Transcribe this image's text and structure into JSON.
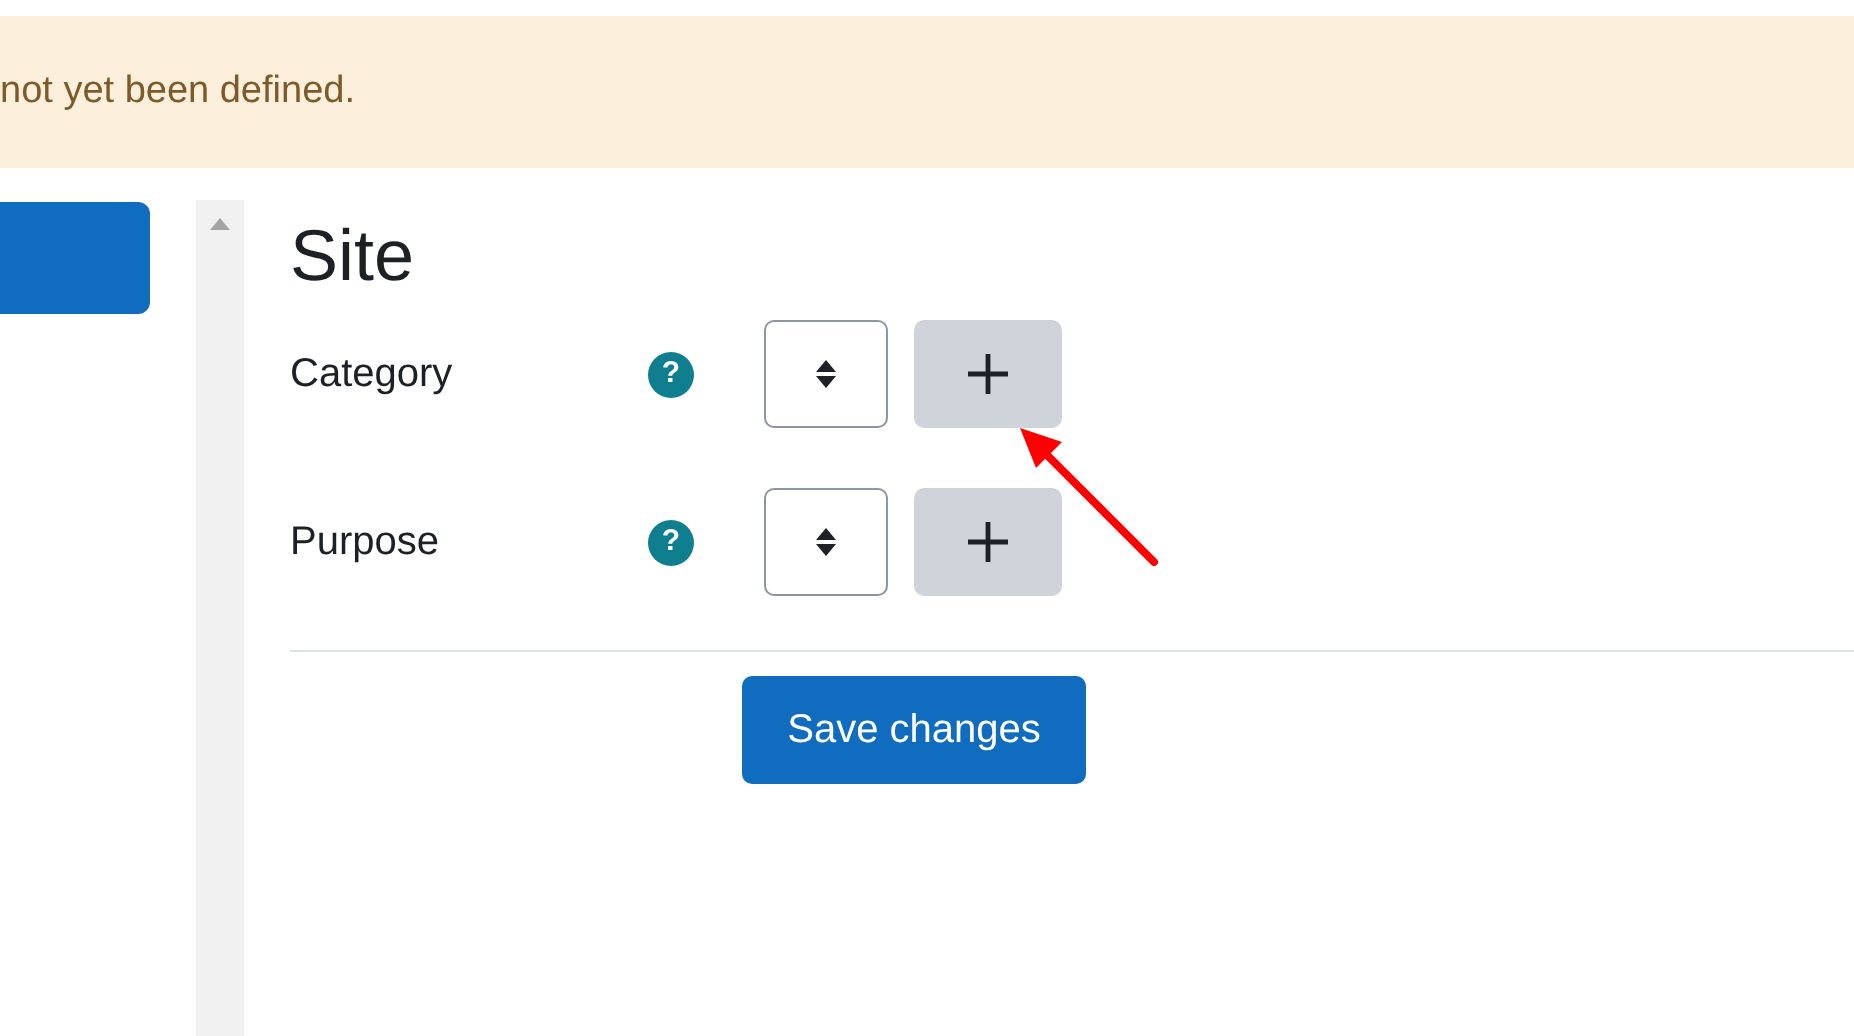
{
  "alert": {
    "text": "not yet been defined."
  },
  "section": {
    "title": "Site",
    "fields": [
      {
        "label": "Category",
        "help": "?"
      },
      {
        "label": "Purpose",
        "help": "?"
      }
    ]
  },
  "save_button": "Save changes"
}
